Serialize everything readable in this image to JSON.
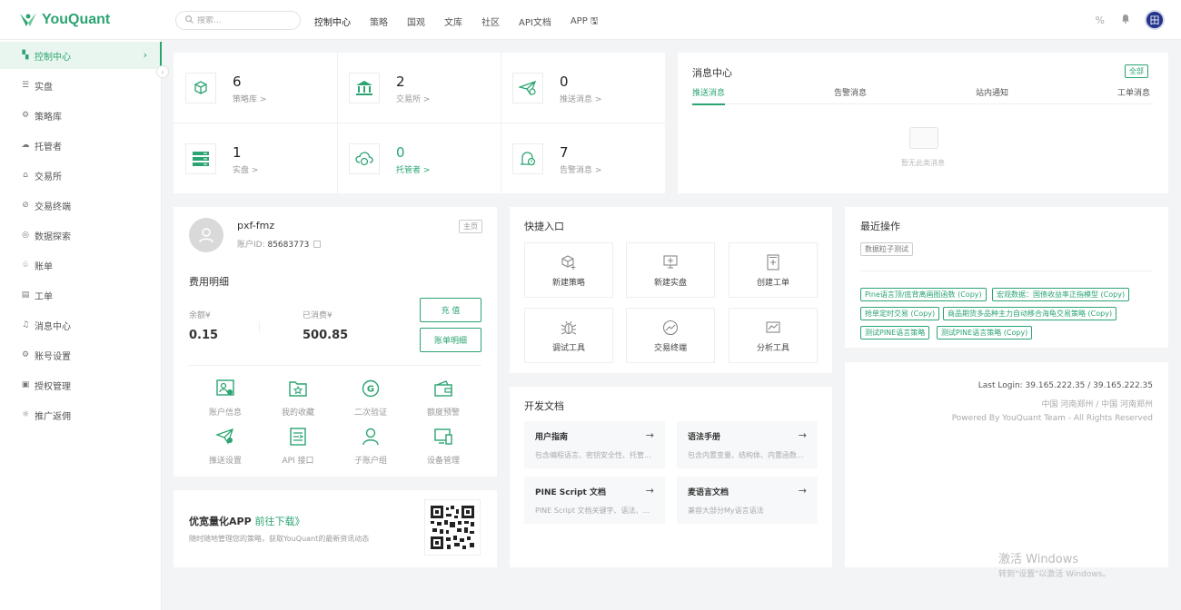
{
  "brand": {
    "name": "YouQuant",
    "color": "#2ba471"
  },
  "search": {
    "placeholder": "搜索..."
  },
  "topnav": [
    "控制中心",
    "策略",
    "国观",
    "文库",
    "社区",
    "API文档",
    "APP 🖫"
  ],
  "header_icons": [
    "percent-icon",
    "bell-icon"
  ],
  "user_avatar_text": "田",
  "sidebar": {
    "items": [
      {
        "label": "控制中心",
        "icon": "dashboard-icon",
        "glyph": "▚",
        "active": true
      },
      {
        "label": "实盘",
        "icon": "list-icon",
        "glyph": "☰"
      },
      {
        "label": "策略库",
        "icon": "gears-icon",
        "glyph": "⚙"
      },
      {
        "label": "托管者",
        "icon": "cloud-icon",
        "glyph": "☁"
      },
      {
        "label": "交易所",
        "icon": "bank-icon",
        "glyph": "⌂"
      },
      {
        "label": "交易终端",
        "icon": "terminal-icon",
        "glyph": "⊘"
      },
      {
        "label": "数据探索",
        "icon": "explore-icon",
        "glyph": "◎"
      },
      {
        "label": "账单",
        "icon": "bill-icon",
        "glyph": "♧"
      },
      {
        "label": "工单",
        "icon": "ticket-icon",
        "glyph": "▤"
      },
      {
        "label": "消息中心",
        "icon": "bell-icon",
        "glyph": "♫"
      },
      {
        "label": "账号设置",
        "icon": "settings-icon",
        "glyph": "⚙"
      },
      {
        "label": "授权管理",
        "icon": "auth-icon",
        "glyph": "▣"
      },
      {
        "label": "推广返佣",
        "icon": "share-icon",
        "glyph": "☼"
      }
    ]
  },
  "stats": [
    {
      "num": "6",
      "label": "策略库 >",
      "icon": "cube-icon"
    },
    {
      "num": "2",
      "label": "交易所 >",
      "icon": "bank-icon"
    },
    {
      "num": "0",
      "label": "推送消息 >",
      "icon": "send-icon"
    },
    {
      "num": "1",
      "label": "实盘 >",
      "icon": "server-icon"
    },
    {
      "num": "0",
      "label": "托管者 >",
      "icon": "cloud-sync-icon"
    },
    {
      "num": "7",
      "label": "告警消息 >",
      "icon": "alarm-icon"
    }
  ],
  "messages": {
    "title": "消息中心",
    "all": "全部",
    "tabs": [
      "推送消息",
      "告警消息",
      "站内通知",
      "工单消息"
    ],
    "empty": "暂无此类消息"
  },
  "account": {
    "name": "pxf-fmz",
    "id_label": "账户ID: ",
    "id": "85683773",
    "home": "主页",
    "fee_title": "费用明细",
    "balance_label": "余额¥",
    "balance": "0.15",
    "spent_label": "已消费¥",
    "spent": "500.85",
    "recharge": "充 值",
    "bill_detail": "账单明细",
    "tools": [
      "账户信息",
      "我的收藏",
      "二次验证",
      "额度预警",
      "推送设置",
      "API 接口",
      "子账户组",
      "设备管理"
    ]
  },
  "app": {
    "title": "优宽量化APP ",
    "link": "前往下载》",
    "desc": "随时随地管理您的策略，获取YouQuant的最新资讯动态"
  },
  "quick": {
    "title": "快捷入口",
    "items": [
      "新建策略",
      "新建实盘",
      "创建工单",
      "调试工具",
      "交易终端",
      "分析工具"
    ]
  },
  "docs": {
    "title": "开发文档",
    "items": [
      {
        "title": "用户指南",
        "desc": "包含编程语言、密钥安全性、托管..."
      },
      {
        "title": "语法手册",
        "desc": "包含内置变量、结构体、内置函数..."
      },
      {
        "title": "PINE Script 文档",
        "desc": "PINE Script 文档关键字、语法、..."
      },
      {
        "title": "麦语言文档",
        "desc": "兼容大部分My语言语法"
      }
    ]
  },
  "recent": {
    "title": "最近操作",
    "tag": "数据粒子测试",
    "items": [
      "Pine语言顶/底背离画图函数 (Copy)",
      "宏观数据：国债收益率正指模型 (Copy)",
      "抢单定时交易 (Copy)",
      "商品期货多品种主力自动移合海龟交易策略 (Copy)",
      "测试PINE语言策略",
      "测试PINE语言策略 (Copy)"
    ]
  },
  "login": {
    "last_login": "Last Login: 39.165.222.35 / 39.165.222.35",
    "location": "中国 河南郑州 / 中国 河南郑州",
    "powered": "Powered By YouQuant Team - All Rights Reserved"
  },
  "watermark": {
    "line1": "激活 Windows",
    "line2": "转到\"设置\"以激活 Windows。"
  }
}
